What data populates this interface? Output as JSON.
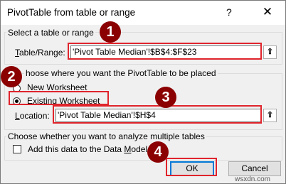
{
  "window": {
    "title": "PivotTable from table or range",
    "help_glyph": "?",
    "close_glyph": "✕"
  },
  "select_section": {
    "heading": "Select a table or range",
    "table_range_label_prefix": "",
    "table_range_label_hotkey": "T",
    "table_range_label_rest": "able/Range:",
    "table_range_value": "'Pivot Table Median'!$B$4:$F$23"
  },
  "placement_section": {
    "heading": "hoose where you want the PivotTable to be placed",
    "option_new": {
      "hotkey": "N",
      "rest": "ew Worksheet",
      "checked": false
    },
    "option_existing": {
      "hotkey": "E",
      "rest": "xisting Worksheet",
      "checked": true
    },
    "location_label_hotkey": "L",
    "location_label_rest": "ocation:",
    "location_value": "'Pivot Table Median'!$H$4"
  },
  "multi_section": {
    "heading": "Choose whether you want to analyze multiple tables",
    "add_to_model_label_prefix": "Add this data to the Data ",
    "add_to_model_label_hotkey": "M",
    "add_to_model_label_rest": "odel",
    "checked": false
  },
  "buttons": {
    "ok_label": "OK",
    "cancel_label": "Cancel"
  },
  "collapse_icon_glyph": "⇧",
  "annotations": {
    "badge_1": "1",
    "badge_2": "2",
    "badge_3": "3",
    "badge_4": "4"
  },
  "watermark": "wsxdn.com",
  "colors": {
    "highlight_box": "#e0242c",
    "badge_fill": "#8b0000",
    "default_button_border": "#0078d7"
  }
}
